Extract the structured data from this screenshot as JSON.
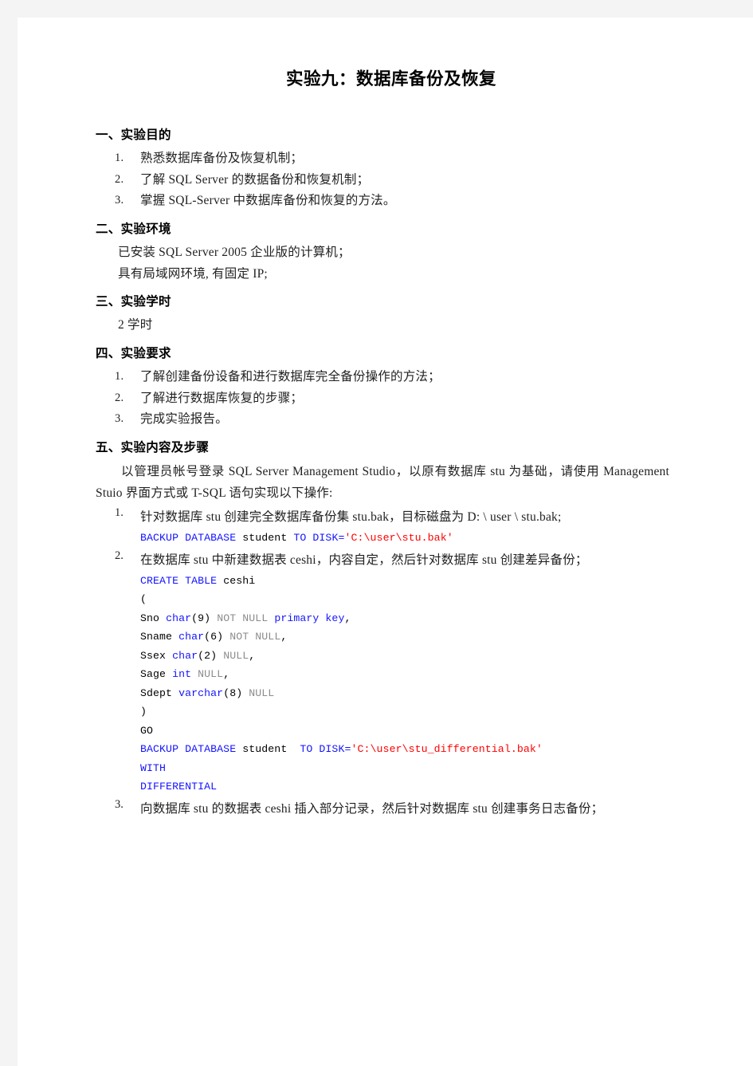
{
  "document": {
    "title": "实验九：数据库备份及恢复",
    "sections": [
      {
        "heading": "一、实验目的",
        "items": [
          {
            "num": "1.",
            "text": "熟悉数据库备份及恢复机制；"
          },
          {
            "num": "2.",
            "text": "了解 SQL Server 的数据备份和恢复机制；"
          },
          {
            "num": "3.",
            "text": "掌握 SQL-Server 中数据库备份和恢复的方法。"
          }
        ]
      },
      {
        "heading": "二、实验环境",
        "lines": [
          "已安装 SQL Server 2005 企业版的计算机；",
          "具有局域网环境, 有固定 IP;"
        ]
      },
      {
        "heading": "三、实验学时",
        "lines": [
          "2 学时"
        ]
      },
      {
        "heading": "四、实验要求",
        "items": [
          {
            "num": "1.",
            "text": "了解创建备份设备和进行数据库完全备份操作的方法；"
          },
          {
            "num": "2.",
            "text": "了解进行数据库恢复的步骤；"
          },
          {
            "num": "3.",
            "text": "完成实验报告。"
          }
        ]
      },
      {
        "heading": "五、实验内容及步骤",
        "intro": "以管理员帐号登录 SQL Server Management Studio，以原有数据库 stu 为基础，请使用 Management Stuio 界面方式或 T-SQL 语句实现以下操作:",
        "steps": [
          {
            "num": "1.",
            "text": "针对数据库 stu 创建完全数据库备份集 stu.bak，目标磁盘为 D: \\ user \\ stu.bak;",
            "code_lines": [
              [
                {
                  "t": "BACKUP DATABASE ",
                  "c": "kw"
                },
                {
                  "t": "student ",
                  "c": "pln"
                },
                {
                  "t": "TO DISK=",
                  "c": "kw"
                },
                {
                  "t": "'C:\\user\\stu.bak'",
                  "c": "str"
                }
              ]
            ]
          },
          {
            "num": "2.",
            "text": "在数据库 stu 中新建数据表 ceshi，内容自定，然后针对数据库 stu 创建差异备份；",
            "code_lines": [
              [
                {
                  "t": "CREATE TABLE ",
                  "c": "kw"
                },
                {
                  "t": "ceshi",
                  "c": "pln"
                }
              ],
              [
                {
                  "t": "(",
                  "c": "pln"
                }
              ],
              [
                {
                  "t": "Sno ",
                  "c": "pln"
                },
                {
                  "t": "char",
                  "c": "kw"
                },
                {
                  "t": "(9) ",
                  "c": "pln"
                },
                {
                  "t": "NOT NULL ",
                  "c": "gray"
                },
                {
                  "t": "primary key",
                  "c": "kw"
                },
                {
                  "t": ",",
                  "c": "pln"
                }
              ],
              [
                {
                  "t": "Sname ",
                  "c": "pln"
                },
                {
                  "t": "char",
                  "c": "kw"
                },
                {
                  "t": "(6) ",
                  "c": "pln"
                },
                {
                  "t": "NOT NULL",
                  "c": "gray"
                },
                {
                  "t": ",",
                  "c": "pln"
                }
              ],
              [
                {
                  "t": "Ssex ",
                  "c": "pln"
                },
                {
                  "t": "char",
                  "c": "kw"
                },
                {
                  "t": "(2) ",
                  "c": "pln"
                },
                {
                  "t": "NULL",
                  "c": "gray"
                },
                {
                  "t": ",",
                  "c": "pln"
                }
              ],
              [
                {
                  "t": "Sage ",
                  "c": "pln"
                },
                {
                  "t": "int",
                  "c": "kw"
                },
                {
                  "t": " ",
                  "c": "pln"
                },
                {
                  "t": "NULL",
                  "c": "gray"
                },
                {
                  "t": ",",
                  "c": "pln"
                }
              ],
              [
                {
                  "t": "Sdept ",
                  "c": "pln"
                },
                {
                  "t": "varchar",
                  "c": "kw"
                },
                {
                  "t": "(8) ",
                  "c": "pln"
                },
                {
                  "t": "NULL",
                  "c": "gray"
                }
              ],
              [
                {
                  "t": ")",
                  "c": "pln"
                }
              ],
              [
                {
                  "t": "GO",
                  "c": "pln"
                }
              ],
              [
                {
                  "t": "BACKUP DATABASE ",
                  "c": "kw"
                },
                {
                  "t": "student  ",
                  "c": "pln"
                },
                {
                  "t": "TO DISK=",
                  "c": "kw"
                },
                {
                  "t": "'C:\\user\\stu_differential.bak'",
                  "c": "str"
                }
              ],
              [
                {
                  "t": "WITH",
                  "c": "kw"
                }
              ],
              [
                {
                  "t": "DIFFERENTIAL",
                  "c": "kw"
                }
              ]
            ]
          },
          {
            "num": "3.",
            "text": "向数据库 stu 的数据表 ceshi 插入部分记录，然后针对数据库 stu 创建事务日志备份；",
            "code_lines": []
          }
        ]
      }
    ]
  },
  "colors": {
    "keyword": "#1414ff",
    "string": "#ff0000",
    "gray_literal": "#8c8c8c",
    "text": "#222222",
    "page_background": "#ffffff",
    "canvas_background": "#f4f4f4"
  }
}
